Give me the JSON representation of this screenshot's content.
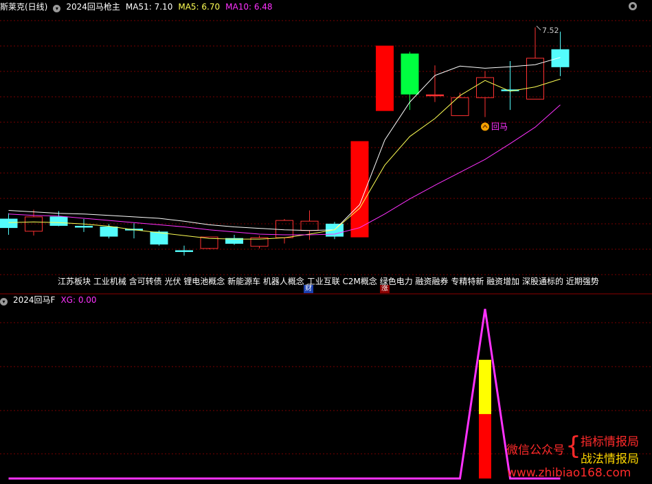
{
  "header": {
    "stock_name": "斯莱克(日线)",
    "indicator_name": "2024回马枪主",
    "ma51": "MA51: 7.10",
    "ma5": "MA5: 6.70",
    "ma10": "MA10: 6.48"
  },
  "sub_header": {
    "indicator_name": "2024回马F",
    "xg": "XG: 0.00"
  },
  "concepts_text": "江苏板块 工业机械 含可转债 光伏 锂电池概念 新能源车 机器人概念 工业互联 C2M概念 绿色电力 融资融券 专精特新 融资增加 深股通标的 近期强势",
  "markers": {
    "cai": "财",
    "zhang": "涨",
    "huima": "回马",
    "high_label": "7.52"
  },
  "watermark": {
    "left": "微信公众号",
    "right1": "指标情报局",
    "right2": "战法情报局",
    "url": "www.zhibiao168.com"
  },
  "colors": {
    "up": "#ff3232",
    "down": "#54fcfc",
    "limit_up": "#ff0000",
    "green": "#00ff40",
    "ma51": "#ffffff",
    "ma5": "#ffff54",
    "ma10": "#ff32ff",
    "separator": "#8b0000"
  },
  "chart_data": [
    {
      "type": "candlestick",
      "title": "2024回马枪主",
      "ylim": [
        4.2,
        7.7
      ],
      "candles": [
        {
          "o": 4.85,
          "h": 4.93,
          "l": 4.63,
          "c": 4.73,
          "fill": "down"
        },
        {
          "o": 4.68,
          "h": 4.98,
          "l": 4.62,
          "c": 4.88,
          "fill": "up"
        },
        {
          "o": 4.88,
          "h": 4.96,
          "l": 4.75,
          "c": 4.76,
          "fill": "down"
        },
        {
          "o": 4.75,
          "h": 4.85,
          "l": 4.67,
          "c": 4.75,
          "fill": "doji"
        },
        {
          "o": 4.74,
          "h": 4.78,
          "l": 4.58,
          "c": 4.61,
          "fill": "down"
        },
        {
          "o": 4.71,
          "h": 4.79,
          "l": 4.58,
          "c": 4.71,
          "fill": "doji"
        },
        {
          "o": 4.67,
          "h": 4.69,
          "l": 4.48,
          "c": 4.5,
          "fill": "down"
        },
        {
          "o": 4.41,
          "h": 4.48,
          "l": 4.34,
          "c": 4.41,
          "fill": "down"
        },
        {
          "o": 4.44,
          "h": 4.6,
          "l": 4.43,
          "c": 4.6,
          "fill": "up"
        },
        {
          "o": 4.58,
          "h": 4.63,
          "l": 4.49,
          "c": 4.51,
          "fill": "down"
        },
        {
          "o": 4.47,
          "h": 4.62,
          "l": 4.44,
          "c": 4.59,
          "fill": "up"
        },
        {
          "o": 4.59,
          "h": 4.85,
          "l": 4.51,
          "c": 4.83,
          "fill": "up"
        },
        {
          "o": 4.69,
          "h": 4.97,
          "l": 4.56,
          "c": 4.82,
          "fill": "up"
        },
        {
          "o": 4.78,
          "h": 4.81,
          "l": 4.57,
          "c": 4.61,
          "fill": "down"
        },
        {
          "o": 4.6,
          "h": 5.93,
          "l": 4.6,
          "c": 5.93,
          "fill": "limit"
        },
        {
          "o": 6.36,
          "h": 7.26,
          "l": 6.36,
          "c": 7.26,
          "fill": "limit"
        },
        {
          "o": 7.15,
          "h": 7.18,
          "l": 6.37,
          "c": 6.59,
          "fill": "green"
        },
        {
          "o": 6.58,
          "h": 6.99,
          "l": 6.48,
          "c": 6.58,
          "fill": "doji_red"
        },
        {
          "o": 6.29,
          "h": 6.61,
          "l": 6.29,
          "c": 6.54,
          "fill": "up"
        },
        {
          "o": 6.54,
          "h": 6.91,
          "l": 6.27,
          "c": 6.82,
          "fill": "up"
        },
        {
          "o": 6.65,
          "h": 7.05,
          "l": 6.37,
          "c": 6.65,
          "fill": "doji"
        },
        {
          "o": 6.52,
          "h": 7.52,
          "l": 6.52,
          "c": 7.09,
          "fill": "up"
        },
        {
          "o": 6.97,
          "h": 7.46,
          "l": 6.84,
          "c": 7.21,
          "fill": "down"
        }
      ],
      "ma51": [
        4.97,
        4.95,
        4.93,
        4.92,
        4.9,
        4.88,
        4.86,
        4.82,
        4.77,
        4.74,
        4.72,
        4.7,
        4.69,
        4.7,
        5.05,
        5.95,
        6.48,
        6.85,
        6.98,
        6.95,
        6.97,
        7.0,
        7.1
      ],
      "ma5": [
        4.8,
        4.81,
        4.8,
        4.78,
        4.75,
        4.7,
        4.66,
        4.62,
        4.58,
        4.57,
        4.57,
        4.59,
        4.64,
        4.7,
        5.0,
        5.6,
        6.0,
        6.25,
        6.57,
        6.78,
        6.63,
        6.69,
        6.8
      ],
      "ma10": [
        4.92,
        4.9,
        4.89,
        4.86,
        4.83,
        4.8,
        4.77,
        4.74,
        4.7,
        4.67,
        4.64,
        4.63,
        4.63,
        4.64,
        4.73,
        4.92,
        5.13,
        5.32,
        5.5,
        5.68,
        5.9,
        6.13,
        6.44
      ],
      "high_index": 21,
      "huima_index": 19
    },
    {
      "type": "area",
      "title": "2024回马F",
      "ylim": [
        0,
        100
      ],
      "signal": [
        0,
        0,
        0,
        0,
        0,
        0,
        0,
        0,
        0,
        0,
        0,
        0,
        0,
        0,
        0,
        0,
        0,
        0,
        0,
        100,
        0,
        0,
        0
      ],
      "bar_index": 19,
      "bar_red_top": 38,
      "bar_yellow_top": 70
    }
  ]
}
